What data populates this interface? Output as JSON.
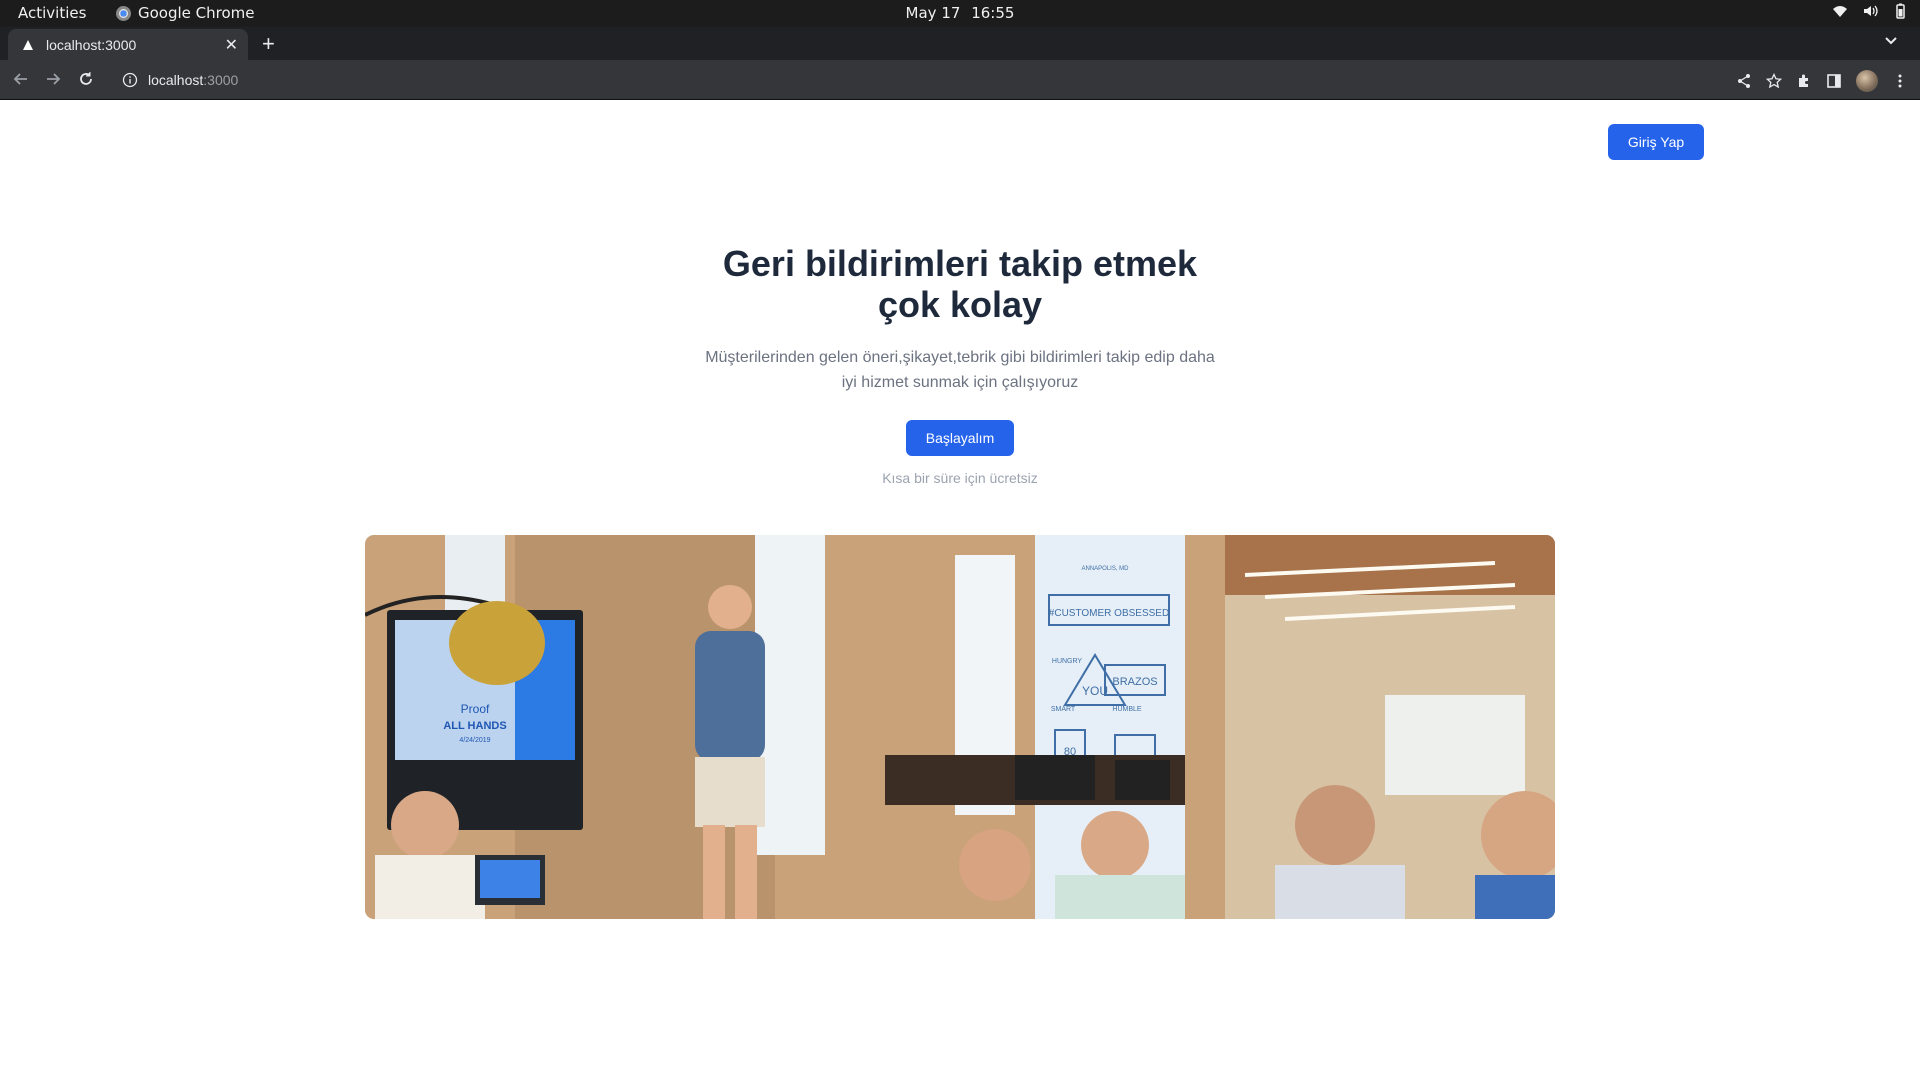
{
  "system_bar": {
    "activities": "Activities",
    "app_name": "Google Chrome",
    "date": "May 17",
    "time": "16:55"
  },
  "browser": {
    "tab_title": "localhost:3000",
    "url_host": "localhost",
    "url_port": ":3000"
  },
  "page": {
    "login_button": "Giriş Yap",
    "headline": "Geri bildirimleri takip etmek çok kolay",
    "subtitle": "Müşterilerinden gelen öneri,şikayet,tebrik gibi bildirimleri takip edip daha iyi hizmet sunmak için çalışıyoruz",
    "cta_button": "Başlayalım",
    "cta_note": "Kısa bir süre için ücretsiz",
    "photo_screen_text": [
      "Proof",
      "ALL HANDS",
      "4/24/2019"
    ],
    "photo_wall_text": [
      "#CUSTOMER OBSESSED",
      "BRAZOS",
      "HUNGRY",
      "YOU",
      "SMART",
      "HUMBLE",
      "80",
      "ANNAPOLIS, MD"
    ]
  },
  "colors": {
    "primary": "#2563eb",
    "heading": "#1e293b",
    "muted": "#6b7280",
    "faint": "#9ca3af"
  }
}
